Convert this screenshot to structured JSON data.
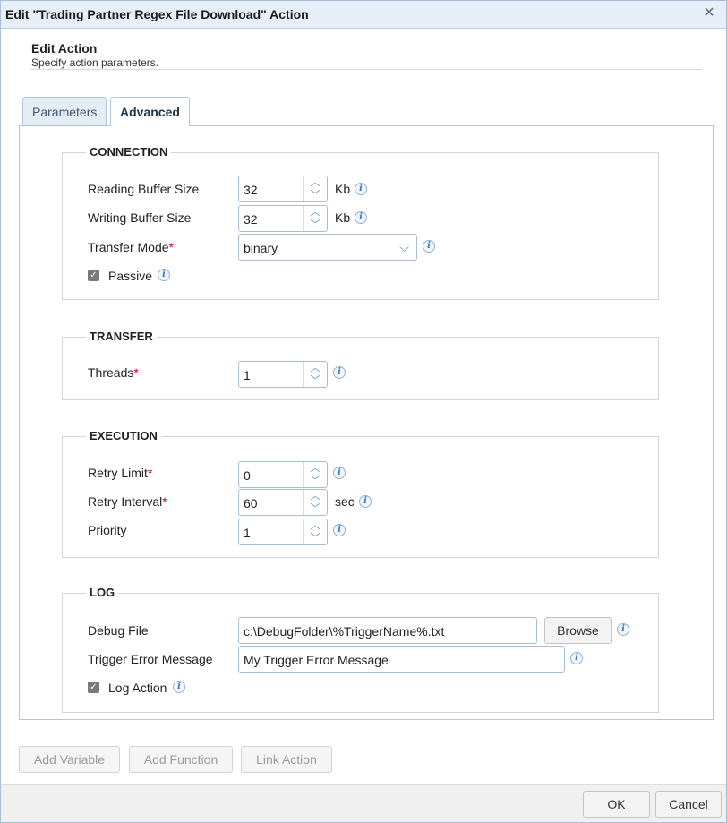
{
  "window": {
    "title": "Edit \"Trading Partner Regex File Download\" Action",
    "close_icon": "close-icon"
  },
  "header": {
    "title": "Edit Action",
    "subtitle": "Specify action parameters."
  },
  "tabs": [
    {
      "label": "Parameters",
      "active": false
    },
    {
      "label": "Advanced",
      "active": true
    }
  ],
  "connection": {
    "legend": "CONNECTION",
    "reading_buffer": {
      "label": "Reading Buffer Size",
      "value": "32",
      "unit": "Kb"
    },
    "writing_buffer": {
      "label": "Writing Buffer Size",
      "value": "32",
      "unit": "Kb"
    },
    "transfer_mode": {
      "label": "Transfer Mode",
      "required": "*",
      "value": "binary"
    },
    "passive": {
      "label": "Passive",
      "checked": true
    }
  },
  "transfer": {
    "legend": "TRANSFER",
    "threads": {
      "label": "Threads",
      "required": "*",
      "value": "1"
    }
  },
  "execution": {
    "legend": "EXECUTION",
    "retry_limit": {
      "label": "Retry Limit",
      "required": "*",
      "value": "0"
    },
    "retry_interval": {
      "label": "Retry Interval",
      "required": "*",
      "value": "60",
      "unit": "sec"
    },
    "priority": {
      "label": "Priority",
      "value": "1"
    }
  },
  "log": {
    "legend": "LOG",
    "debug_file": {
      "label": "Debug File",
      "value": "c:\\DebugFolder\\%TriggerName%.txt",
      "browse_label": "Browse"
    },
    "trigger_error": {
      "label": "Trigger Error Message",
      "value": "My Trigger Error Message"
    },
    "log_action": {
      "label": "Log Action",
      "checked": true
    }
  },
  "bottom_buttons": {
    "add_variable": "Add Variable",
    "add_function": "Add Function",
    "link_action": "Link Action"
  },
  "footer": {
    "ok": "OK",
    "cancel": "Cancel"
  },
  "colors": {
    "accent": "#5a8fc2",
    "required": "#d0021b",
    "titlebar": "#e6eef7"
  }
}
